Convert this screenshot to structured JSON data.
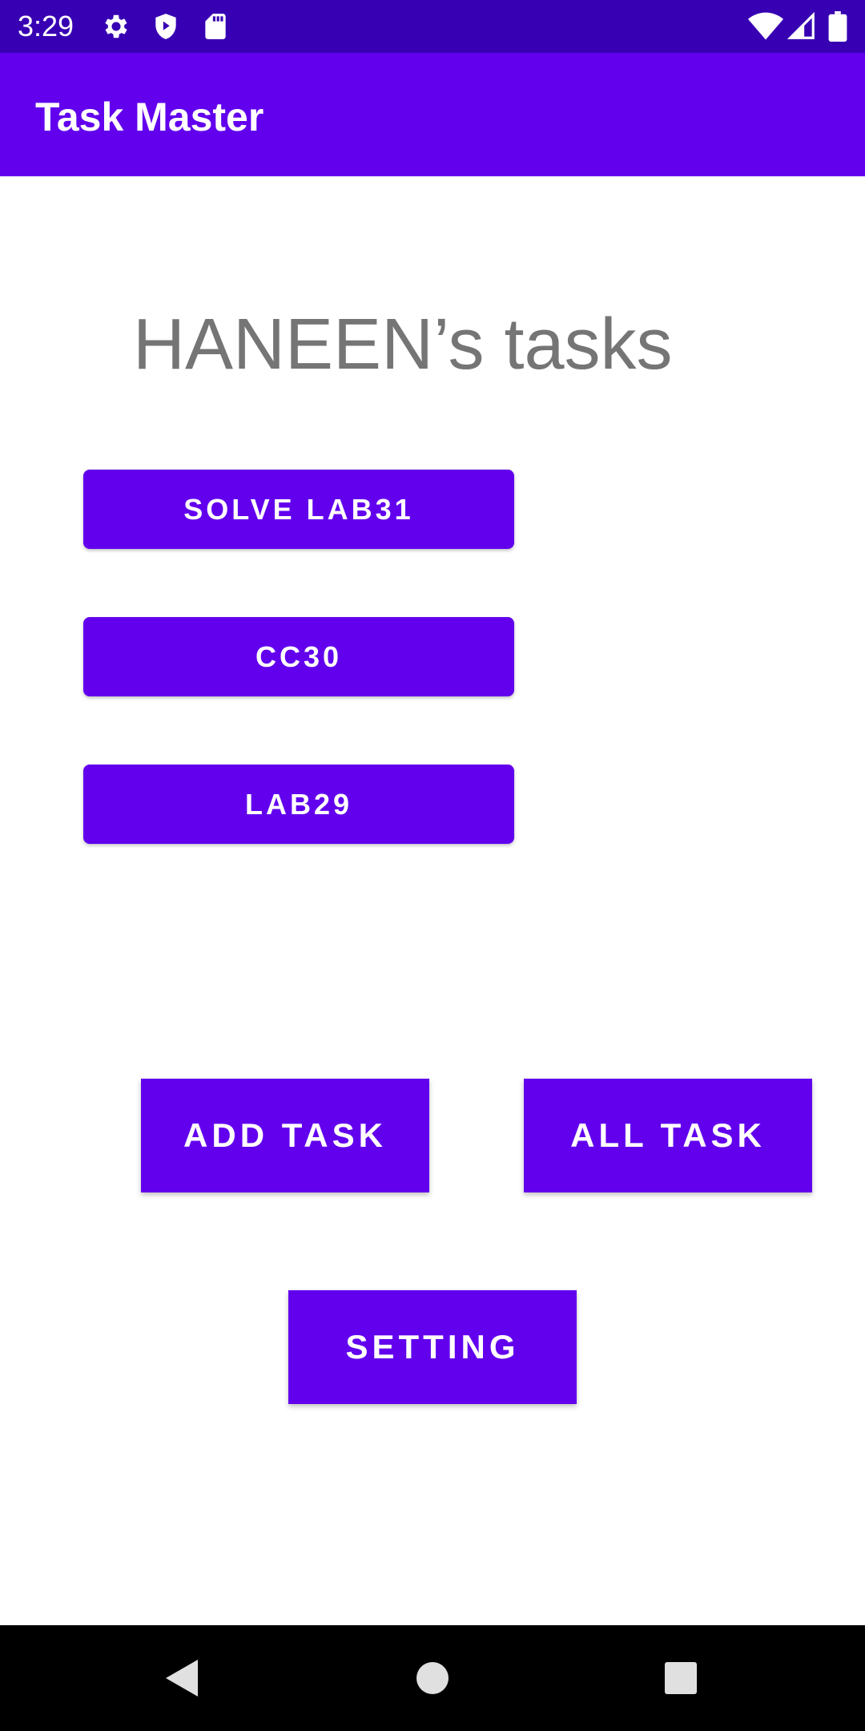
{
  "status_bar": {
    "time": "3:29",
    "icons_left": [
      "gear-icon",
      "shield-play-icon",
      "sd-card-icon"
    ],
    "icons_right": [
      "wifi-icon",
      "signal-icon",
      "battery-icon"
    ]
  },
  "app_bar": {
    "title": "Task Master"
  },
  "main": {
    "heading": "HANEEN’s tasks",
    "tasks": [
      {
        "label": "SOLVE LAB31"
      },
      {
        "label": "CC30"
      },
      {
        "label": "LAB29"
      }
    ],
    "actions": {
      "add_task": "ADD TASK",
      "all_task": "ALL TASK",
      "setting": "SETTING"
    }
  },
  "nav_bar": {
    "icons": [
      "back-icon",
      "home-icon",
      "recents-icon"
    ]
  },
  "colors": {
    "status_bar": "#3700b3",
    "primary": "#6200ee",
    "heading_text": "#757575",
    "nav_bar": "#000000"
  }
}
